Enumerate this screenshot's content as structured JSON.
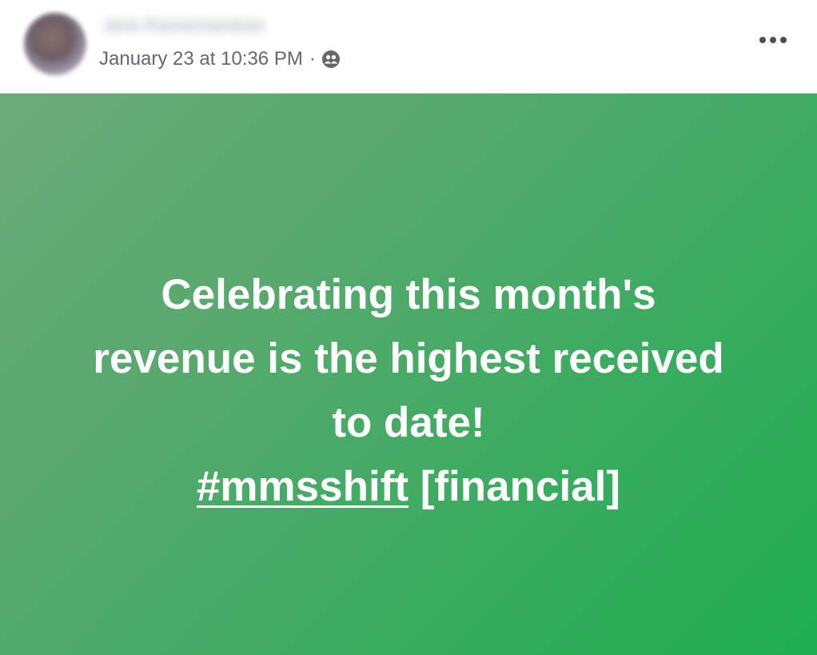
{
  "header": {
    "author_name": "Jane Ramachandran",
    "timestamp": "January 23 at 10:36 PM",
    "separator": "·",
    "audience_icon": "friends-audience-icon",
    "more_icon": "more-options-icon"
  },
  "post": {
    "background_colors": [
      "#6bab7a",
      "#1fae51"
    ],
    "text_color": "#ffffff",
    "lines": [
      "Celebrating this month's",
      "revenue is the highest received",
      "to date!"
    ],
    "hashtag": "#mmsshift",
    "tag": "[financial]"
  }
}
